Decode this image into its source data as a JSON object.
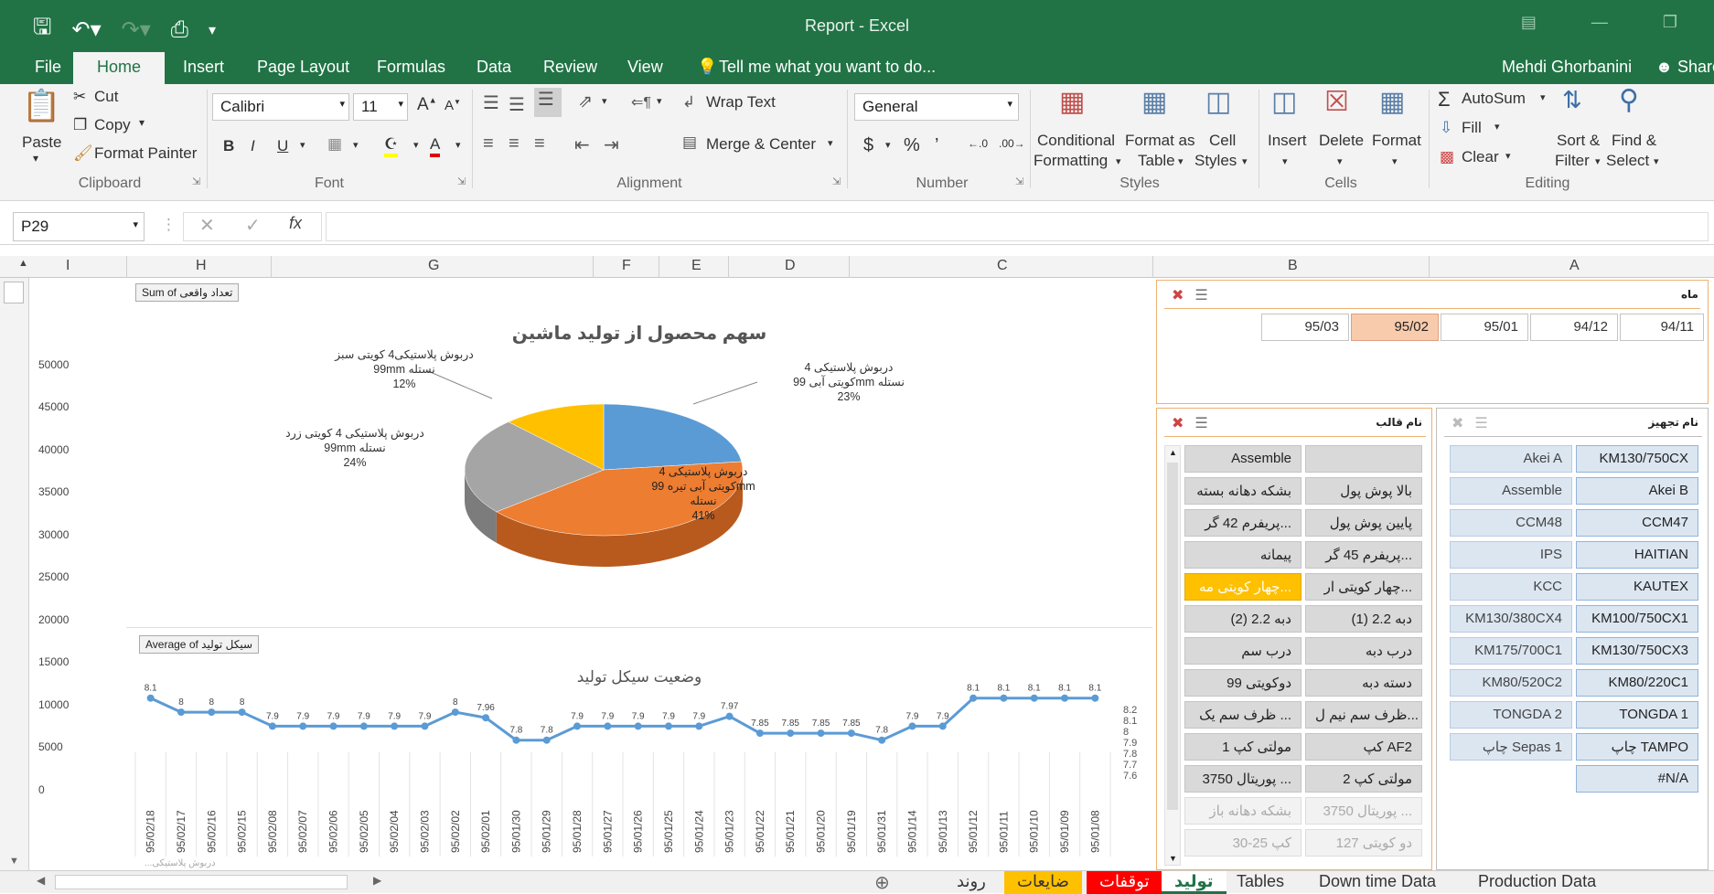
{
  "app": {
    "title": "Report - Excel",
    "user": "Mehdi Ghorbanini",
    "share": "Share"
  },
  "menu": {
    "file": "File",
    "home": "Home",
    "insert": "Insert",
    "page_layout": "Page Layout",
    "formulas": "Formulas",
    "data": "Data",
    "review": "Review",
    "view": "View",
    "tell": "Tell me what you want to do..."
  },
  "ribbon": {
    "paste": "Paste",
    "cut": "Cut",
    "copy": "Copy",
    "format_painter": "Format Painter",
    "clipboard": "Clipboard",
    "font_name": "Calibri",
    "font_size": "11",
    "font": "Font",
    "wrap_text": "Wrap Text",
    "merge_center": "Merge & Center",
    "alignment": "Alignment",
    "number_format": "General",
    "number": "Number",
    "cond_fmt_1": "Conditional",
    "cond_fmt_2": "Formatting",
    "fmt_table_1": "Format as",
    "fmt_table_2": "Table",
    "cell_styles_1": "Cell",
    "cell_styles_2": "Styles",
    "styles": "Styles",
    "insert": "Insert",
    "delete": "Delete",
    "format": "Format",
    "cells": "Cells",
    "autosum": "AutoSum",
    "fill": "Fill",
    "clear": "Clear",
    "sort_1": "Sort &",
    "sort_2": "Filter",
    "find_1": "Find &",
    "find_2": "Select",
    "editing": "Editing"
  },
  "formula_bar": {
    "name_box": "P29",
    "formula": ""
  },
  "columns": [
    "I",
    "H",
    "G",
    "F",
    "E",
    "D",
    "C",
    "B",
    "A"
  ],
  "y_axis_labels": [
    "50000",
    "45000",
    "40000",
    "35000",
    "30000",
    "25000",
    "20000",
    "15000",
    "10000",
    "5000",
    "0"
  ],
  "pie": {
    "field_button": "Sum of تعداد واقعی",
    "title": "سهم محصول از تولید ماشین",
    "labels": [
      {
        "l1": "دربوش پلاستیکی 4",
        "l2": "کویتی آبی 99mm نستله",
        "pct": "23%"
      },
      {
        "l1": "دربوش پلاستیکی 4",
        "l2": "کویتی آبی تیره 99mm",
        "l3": "نستله",
        "pct": "41%"
      },
      {
        "l1": "دربوش پلاستیکی 4 کویتی زرد",
        "l2": "99mm نستله",
        "pct": "24%"
      },
      {
        "l1": "دربوش پلاستیکی4 کویتی سبز",
        "l2": "99mm نستله",
        "pct": "12%"
      }
    ]
  },
  "line": {
    "field_button": "Average of سیکل تولید",
    "title": "وضعیت سیکل تولید",
    "right_axis": [
      "8.2",
      "8.1",
      "8",
      "7.9",
      "7.8",
      "7.7",
      "7.6"
    ],
    "bottom_strip": "...دربوش پلاستیکی"
  },
  "chart_data": {
    "type": "line",
    "title": "وضعیت سیکل تولید",
    "categories": [
      "95/02/18",
      "95/02/17",
      "95/02/16",
      "95/02/15",
      "95/02/08",
      "95/02/07",
      "95/02/06",
      "95/02/05",
      "95/02/04",
      "95/02/03",
      "95/02/02",
      "95/02/01",
      "95/01/30",
      "95/01/29",
      "95/01/28",
      "95/01/27",
      "95/01/26",
      "95/01/25",
      "95/01/24",
      "95/01/23",
      "95/01/22",
      "95/01/21",
      "95/01/20",
      "95/01/19",
      "95/01/31",
      "95/01/14",
      "95/01/13",
      "95/01/12",
      "95/01/11",
      "95/01/10",
      "95/01/09",
      "95/01/08"
    ],
    "values": [
      8.1,
      8,
      8,
      8,
      7.9,
      7.9,
      7.9,
      7.9,
      7.9,
      7.9,
      8,
      7.96,
      7.8,
      7.8,
      7.9,
      7.9,
      7.9,
      7.9,
      7.9,
      7.97,
      7.85,
      7.85,
      7.85,
      7.85,
      7.8,
      7.9,
      7.9,
      8.1,
      8.1,
      8.1,
      8.1,
      8.1
    ],
    "value_labels": [
      "8.1",
      "8",
      "8",
      "8",
      "7.9",
      "7.9",
      "7.9",
      "7.9",
      "7.9",
      "7.9",
      "8",
      "7.96",
      "7.8",
      "7.8",
      "7.9",
      "7.9",
      "7.9",
      "7.9",
      "7.9",
      "7.97",
      "7.85",
      "7.85",
      "7.85",
      "7.85",
      "7.8",
      "7.9",
      "7.9",
      "8.1",
      "8.1",
      "8.1",
      "8.1",
      "8.1"
    ],
    "ylim": [
      7.6,
      8.2
    ],
    "color": "#5b9bd5"
  },
  "pie_chart_data": {
    "type": "pie",
    "values": [
      23,
      41,
      24,
      12
    ],
    "colors": [
      "#5b9bd5",
      "#ed7d31",
      "#a5a5a5",
      "#ffc000"
    ]
  },
  "slicer_month": {
    "header": "ماه",
    "items": [
      "95/03",
      "95/02",
      "95/01",
      "94/12",
      "94/11"
    ],
    "selected": "95/02"
  },
  "slicer_mold": {
    "header": "نام قالب",
    "rows": [
      [
        "Assemble",
        ""
      ],
      [
        "بشکه دهانه بسته",
        "بالا پوش پول"
      ],
      [
        "پریفرم 42 گر...",
        "پایین پوش پول"
      ],
      [
        "پیمانه",
        "پریفرم 45 گر..."
      ],
      [
        "چهار کویتی مه...",
        "چهار کویتی ار..."
      ],
      [
        "دبه 2.2 (2)",
        "دبه 2.2 (1)"
      ],
      [
        "درب سم",
        "درب دبه"
      ],
      [
        "دوکویتی 99",
        "دسته دبه"
      ],
      [
        "ظرف سم یک ...",
        "ظرف سم نیم ل..."
      ],
      [
        "مولتی کپ 1",
        "کپ AF2"
      ],
      [
        "پوریتال 3750 ...",
        "مولتی کپ 2"
      ],
      [
        "بشکه دهانه باز",
        "پوریتال 3750 ..."
      ],
      [
        "کپ 25-30",
        "دو کویتی 127"
      ]
    ]
  },
  "slicer_equip": {
    "header": "نام تجهیز",
    "rows": [
      [
        "Akei A",
        "KM130/750CX"
      ],
      [
        "Assemble",
        "Akei B"
      ],
      [
        "CCM48",
        "CCM47"
      ],
      [
        "IPS",
        "HAITIAN"
      ],
      [
        "KCC",
        "KAUTEX"
      ],
      [
        "KM130/380CX4",
        "KM100/750CX1"
      ],
      [
        "KM175/700C1",
        "KM130/750CX3"
      ],
      [
        "KM80/520C2",
        "KM80/220C1"
      ],
      [
        "TONGDA 2",
        "TONGDA 1"
      ],
      [
        "چاپ Sepas 1",
        "چاپ TAMPO"
      ],
      [
        "",
        "#N/A"
      ]
    ]
  },
  "sheets": {
    "rond": "روند",
    "zayeat": "ضایعات",
    "tavaghofat": "توقفات",
    "tolid": "تولید",
    "tables": "Tables",
    "downtime": "Down time Data",
    "production": "Production Data"
  }
}
